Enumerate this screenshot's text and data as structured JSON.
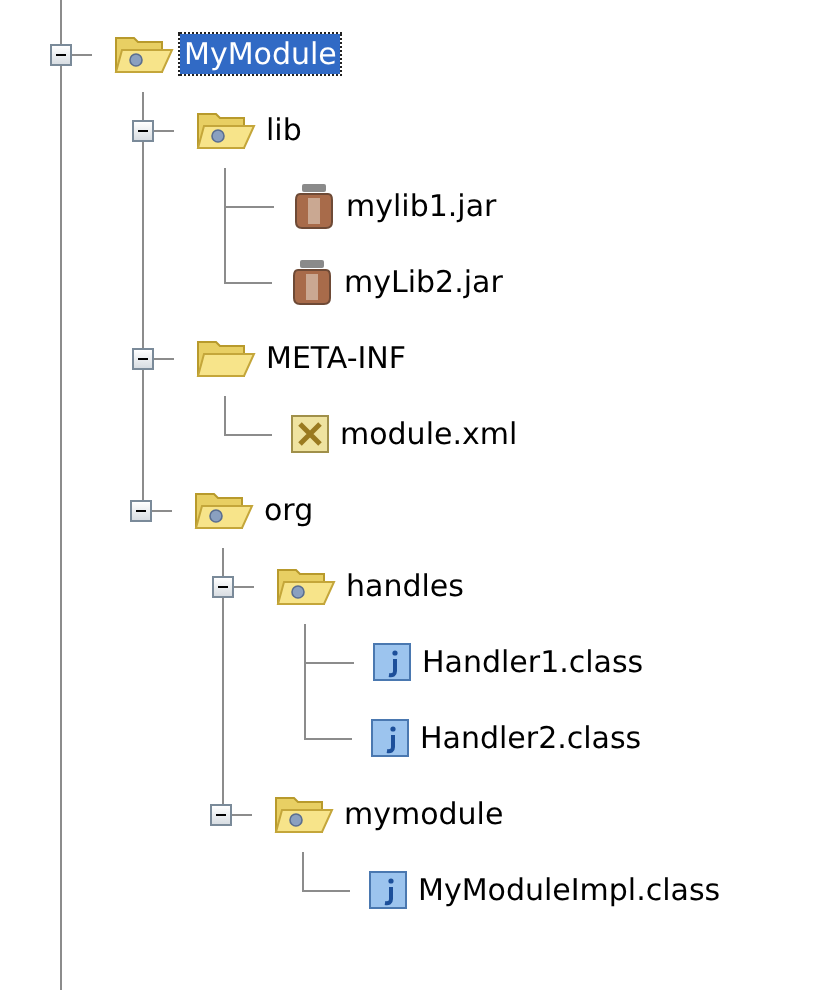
{
  "tree": [
    {
      "label": "MyModule",
      "kind": "package_folder",
      "selected": true,
      "expanded": true,
      "children": [
        {
          "label": "lib",
          "kind": "package_folder",
          "selected": false,
          "expanded": true,
          "children": [
            {
              "label": "mylib1.jar",
              "kind": "jar",
              "selected": false
            },
            {
              "label": "myLib2.jar",
              "kind": "jar",
              "selected": false
            }
          ]
        },
        {
          "label": "META-INF",
          "kind": "folder",
          "selected": false,
          "expanded": true,
          "children": [
            {
              "label": "module.xml",
              "kind": "xml",
              "selected": false
            }
          ]
        },
        {
          "label": "org",
          "kind": "package_folder",
          "selected": false,
          "expanded": true,
          "children": [
            {
              "label": "handles",
              "kind": "package_folder",
              "selected": false,
              "expanded": true,
              "children": [
                {
                  "label": "Handler1.class",
                  "kind": "java",
                  "selected": false
                },
                {
                  "label": "Handler2.class",
                  "kind": "java",
                  "selected": false
                }
              ]
            },
            {
              "label": "mymodule",
              "kind": "package_folder",
              "selected": false,
              "expanded": true,
              "children": [
                {
                  "label": "MyModuleImpl.class",
                  "kind": "java",
                  "selected": false
                }
              ]
            }
          ]
        }
      ]
    }
  ]
}
